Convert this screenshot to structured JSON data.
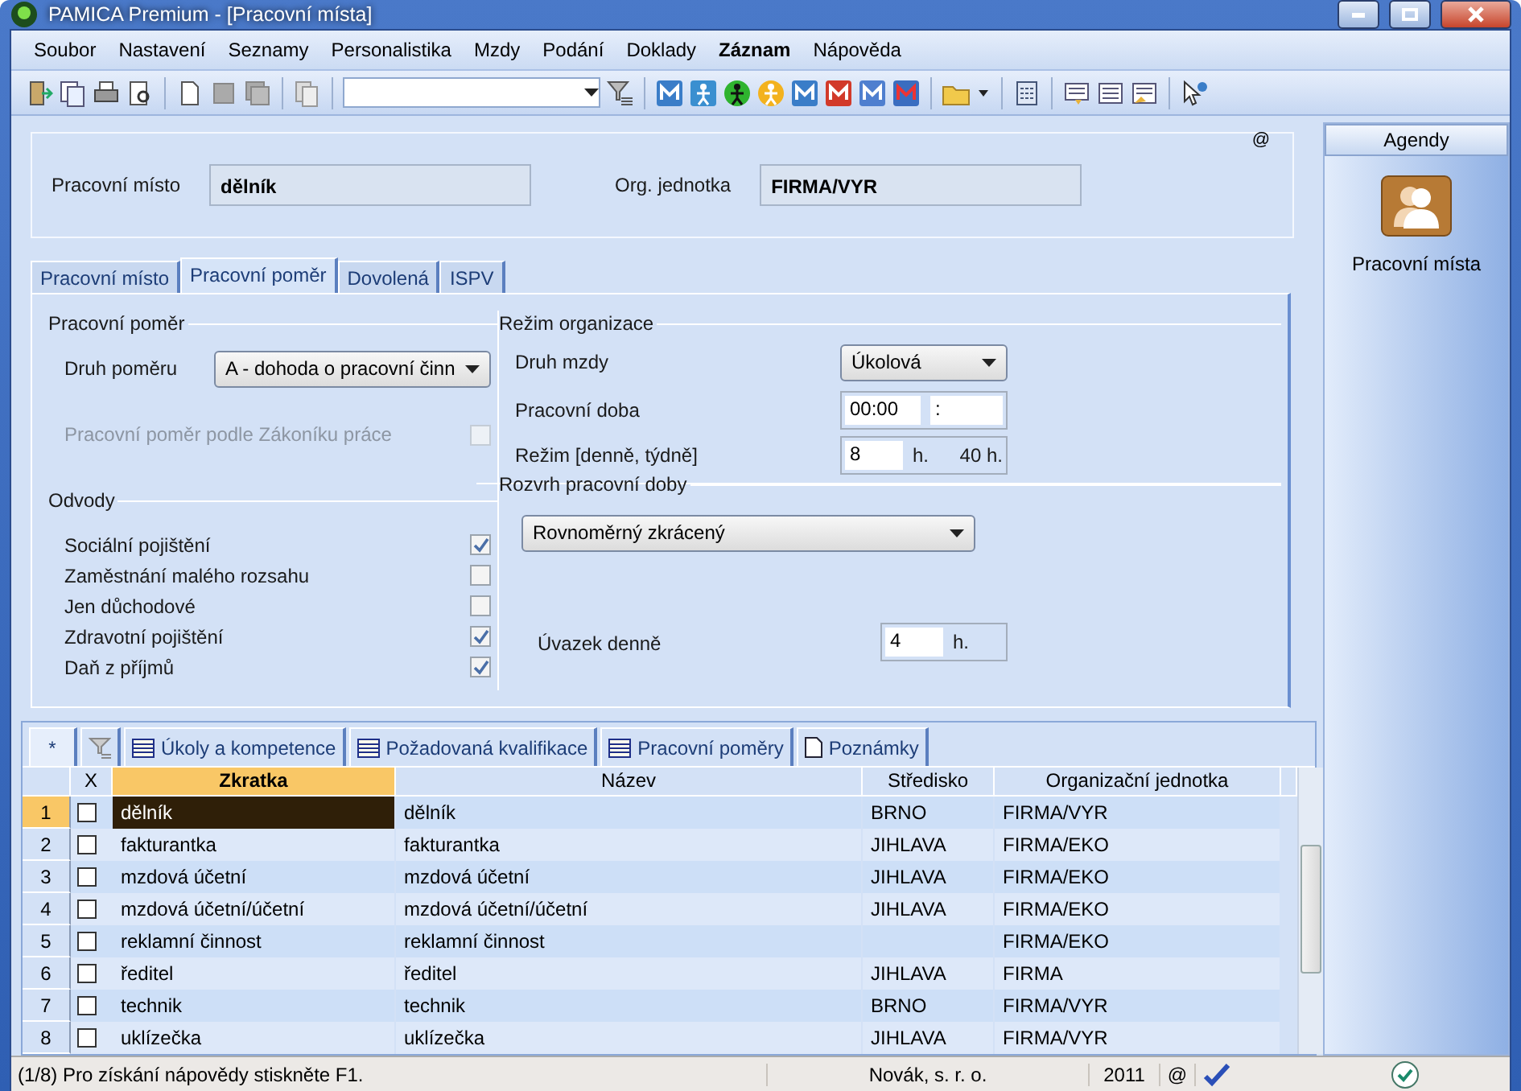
{
  "window": {
    "title": "PAMICA Premium - [Pracovní místa]"
  },
  "menu": [
    {
      "label": "Soubor",
      "bold": false
    },
    {
      "label": "Nastavení",
      "bold": false
    },
    {
      "label": "Seznamy",
      "bold": false
    },
    {
      "label": "Personalistika",
      "bold": false
    },
    {
      "label": "Mzdy",
      "bold": false
    },
    {
      "label": "Podání",
      "bold": false
    },
    {
      "label": "Doklady",
      "bold": false
    },
    {
      "label": "Záznam",
      "bold": true
    },
    {
      "label": "Nápověda",
      "bold": false
    }
  ],
  "header": {
    "fields": [
      {
        "label": "Pracovní místo",
        "value": "dělník"
      },
      {
        "label": "Org. jednotka",
        "value": "FIRMA/VYR"
      }
    ],
    "marker": "@"
  },
  "tabs": [
    {
      "label": "Pracovní místo",
      "selected": false
    },
    {
      "label": "Pracovní poměr",
      "selected": true
    },
    {
      "label": "Dovolená",
      "selected": false
    },
    {
      "label": "ISPV",
      "selected": false
    }
  ],
  "pracovni_pomer": {
    "title": "Pracovní poměr",
    "druh_label": "Druh poměru",
    "druh_value": "A - dohoda o pracovní činn",
    "zakonik": {
      "label": "Pracovní poměr podle Zákoníku práce",
      "checked": false,
      "disabled": true
    }
  },
  "odvody": {
    "title": "Odvody",
    "items": [
      {
        "label": "Sociální pojištění",
        "checked": true
      },
      {
        "label": "Zaměstnání malého rozsahu",
        "checked": false
      },
      {
        "label": "Jen důchodové",
        "checked": false
      },
      {
        "label": "Zdravotní pojištění",
        "checked": true
      },
      {
        "label": "Daň z příjmů",
        "checked": true
      }
    ]
  },
  "rezim": {
    "title": "Režim organizace",
    "druh_mzdy": {
      "label": "Druh mzdy",
      "value": "Úkolová"
    },
    "pracovni_doba": {
      "label": "Pracovní doba",
      "from": "00:00",
      "to": ":"
    },
    "rezim": {
      "label": "Režim [denně, týdně]",
      "daily": "8",
      "unit": "h.",
      "weekly": "40 h."
    }
  },
  "rozvrh": {
    "title": "Rozvrh pracovní doby",
    "value": "Rovnoměrný zkrácený",
    "uvazek": {
      "label": "Úvazek denně",
      "value": "4",
      "unit": "h."
    }
  },
  "detail_tabs": [
    {
      "kind": "new",
      "label": "*",
      "selected": true
    },
    {
      "kind": "filter",
      "selected": false
    },
    {
      "kind": "list",
      "label": "Úkoly a kompetence",
      "selected": false
    },
    {
      "kind": "list",
      "label": "Požadovaná kvalifikace",
      "selected": false
    },
    {
      "kind": "list",
      "label": "Pracovní poměry",
      "selected": false
    },
    {
      "kind": "note",
      "label": "Poznámky",
      "selected": false
    }
  ],
  "table": {
    "checkbox_column": "X",
    "columns": [
      {
        "label": "Zkratka",
        "sorted": true
      },
      {
        "label": "Název",
        "sorted": false
      },
      {
        "label": "Středisko",
        "sorted": false
      },
      {
        "label": "Organizační jednotka",
        "sorted": false
      }
    ],
    "rows": [
      {
        "number": "1",
        "selected": true,
        "checked": false,
        "cells": [
          "dělník",
          "dělník",
          "BRNO",
          "FIRMA/VYR"
        ]
      },
      {
        "number": "2",
        "selected": false,
        "checked": false,
        "cells": [
          "fakturantka",
          "fakturantka",
          "JIHLAVA",
          "FIRMA/EKO"
        ]
      },
      {
        "number": "3",
        "selected": false,
        "checked": false,
        "cells": [
          "mzdová účetní",
          "mzdová účetní",
          "JIHLAVA",
          "FIRMA/EKO"
        ]
      },
      {
        "number": "4",
        "selected": false,
        "checked": false,
        "cells": [
          "mzdová účetní/účetní",
          "mzdová účetní/účetní",
          "JIHLAVA",
          "FIRMA/EKO"
        ]
      },
      {
        "number": "5",
        "selected": false,
        "checked": false,
        "cells": [
          "reklamní činnost",
          "reklamní činnost",
          "",
          "FIRMA/EKO"
        ]
      },
      {
        "number": "6",
        "selected": false,
        "checked": false,
        "cells": [
          "ředitel",
          "ředitel",
          "JIHLAVA",
          "FIRMA"
        ]
      },
      {
        "number": "7",
        "selected": false,
        "checked": false,
        "cells": [
          "technik",
          "technik",
          "BRNO",
          "FIRMA/VYR"
        ]
      },
      {
        "number": "8",
        "selected": false,
        "checked": false,
        "cells": [
          "uklízečka",
          "uklízečka",
          "JIHLAVA",
          "FIRMA/VYR"
        ]
      }
    ]
  },
  "agendy": {
    "title": "Agendy",
    "items": [
      {
        "label": "Pracovní místa"
      }
    ]
  },
  "status_bar": {
    "message": "(1/8) Pro získání nápovědy stiskněte F1.",
    "company": "Novák, s. r. o.",
    "year": "2011",
    "marker": "@"
  }
}
